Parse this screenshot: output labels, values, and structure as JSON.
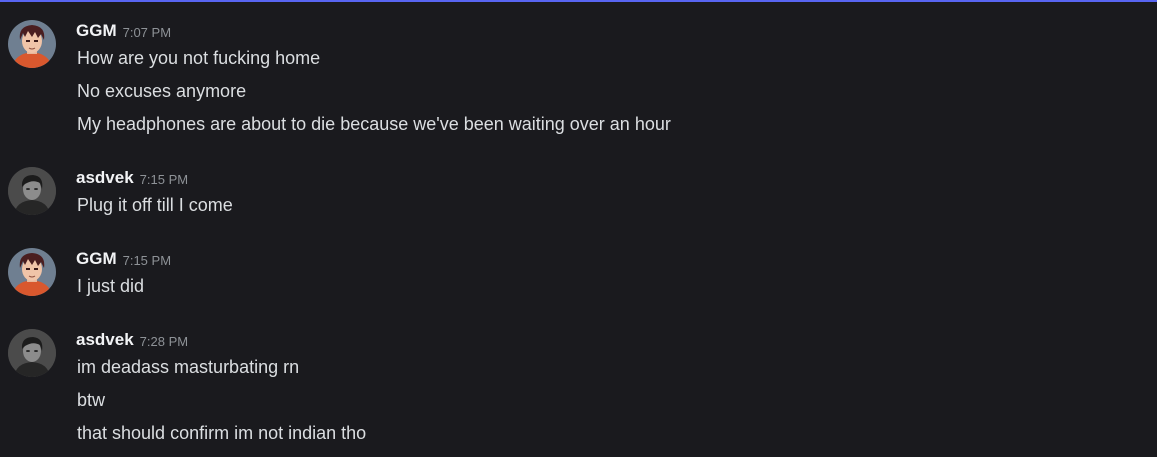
{
  "messages": [
    {
      "author": "GGM",
      "time": "7:07 PM",
      "avatar_icon": "anime-avatar-icon",
      "lines": [
        "How are you not fucking home",
        "No excuses anymore",
        "My headphones are about to die because we've been waiting over an hour"
      ]
    },
    {
      "author": "asdvek",
      "time": "7:15 PM",
      "avatar_icon": "grayscale-photo-avatar-icon",
      "lines": [
        "Plug it off till I come"
      ]
    },
    {
      "author": "GGM",
      "time": "7:15 PM",
      "avatar_icon": "anime-avatar-icon",
      "lines": [
        "I just did"
      ]
    },
    {
      "author": "asdvek",
      "time": "7:28 PM",
      "avatar_icon": "grayscale-photo-avatar-icon",
      "lines": [
        "im deadass masturbating rn",
        "btw",
        "that should confirm im not indian tho"
      ]
    }
  ],
  "colors": {
    "background": "#1a1a1e",
    "accent_line": "#5865f2",
    "username": "#f2f3f5",
    "timestamp": "#8e9297",
    "message_text": "#dbdee1"
  }
}
